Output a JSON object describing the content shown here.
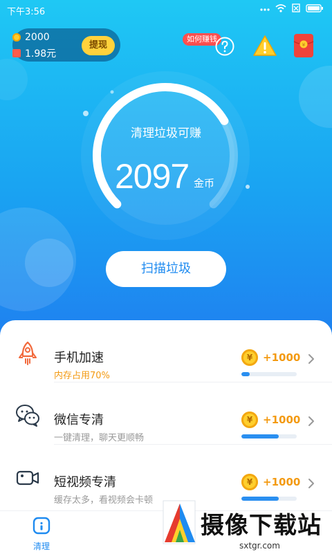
{
  "status_bar": {
    "time": "下午3:56"
  },
  "wallet": {
    "coins": "2000",
    "cash": "1.98元",
    "withdraw_label": "提现"
  },
  "header": {
    "earn_tip": "如何赚钱"
  },
  "gauge": {
    "title": "清理垃圾可赚",
    "value": "2097",
    "unit": "金币",
    "fill_fraction": 0.72
  },
  "scan_button": {
    "label": "扫描垃圾"
  },
  "items": [
    {
      "icon": "rocket-icon",
      "title": "手机加速",
      "subtitle": "内存占用70%",
      "reward": "+1000",
      "coin_symbol": "¥",
      "progress": 0.15
    },
    {
      "icon": "wechat-icon",
      "title": "微信专清",
      "subtitle": "一键清理，聊天更顺畅",
      "reward": "+1000",
      "coin_symbol": "¥",
      "progress": 0.68
    },
    {
      "icon": "video-camera-icon",
      "title": "短视频专清",
      "subtitle": "缓存太多，看视频会卡顿",
      "reward": "+1000",
      "coin_symbol": "¥",
      "progress": 0.68
    }
  ],
  "tabbar": {
    "tabs": [
      {
        "label": "清理",
        "active": true
      }
    ]
  },
  "watermark": {
    "text": "摄像下载站",
    "url": "sxtgr.com"
  },
  "colors": {
    "accent": "#1f8bf0",
    "reward": "#f39a12",
    "hero_top": "#1fc8f4",
    "hero_bottom": "#1f7ff0"
  }
}
